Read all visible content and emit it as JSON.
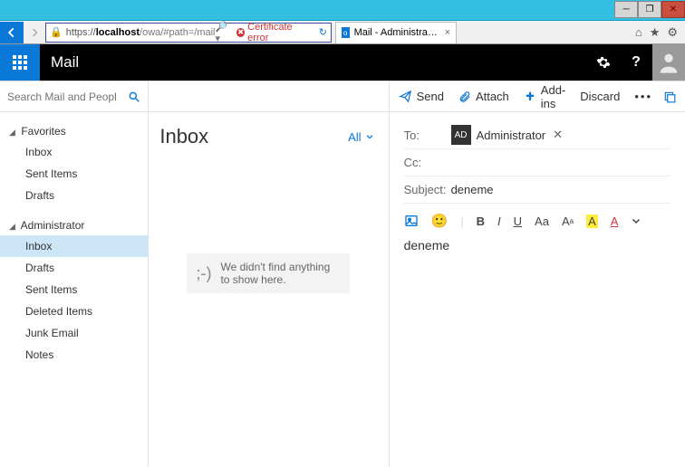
{
  "browser": {
    "url_prefix": "https://",
    "host": "localhost",
    "path": "/owa/#path=/mail",
    "cert_error": "Certificate error",
    "tab_title": "Mail - Administrator - Outl..."
  },
  "appbar": {
    "name": "Mail"
  },
  "search_placeholder": "Search Mail and People",
  "nav": {
    "favorites_label": "Favorites",
    "favorites": [
      {
        "label": "Inbox"
      },
      {
        "label": "Sent Items"
      },
      {
        "label": "Drafts"
      }
    ],
    "account_label": "Administrator",
    "account_items": [
      {
        "label": "Inbox",
        "selected": true
      },
      {
        "label": "Drafts"
      },
      {
        "label": "Sent Items"
      },
      {
        "label": "Deleted Items"
      },
      {
        "label": "Junk Email"
      },
      {
        "label": "Notes"
      }
    ]
  },
  "inbox": {
    "title": "Inbox",
    "filter": "All",
    "empty_message": "We didn't find anything to show here."
  },
  "compose_toolbar": {
    "send": "Send",
    "attach": "Attach",
    "addins": "Add-ins",
    "discard": "Discard"
  },
  "compose": {
    "to_label": "To:",
    "to_chip_initials": "AD",
    "to_chip_name": "Administrator",
    "cc_label": "Cc:",
    "subject_label": "Subject:",
    "subject_value": "deneme",
    "body": "deneme"
  },
  "format": {
    "bold": "B",
    "italic": "I",
    "underline": "U",
    "case": "Aa",
    "size": "A",
    "highlight": "A",
    "color": "A"
  }
}
